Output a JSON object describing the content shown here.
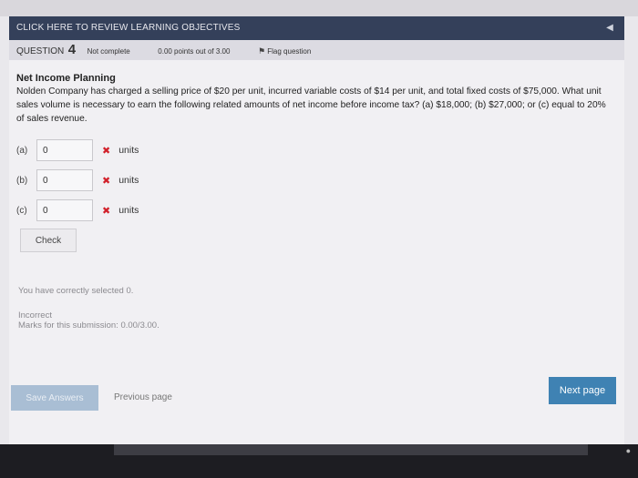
{
  "objectives_bar": {
    "label": "CLICK HERE TO REVIEW LEARNING OBJECTIVES"
  },
  "question_bar": {
    "question_label": "QUESTION",
    "question_number": "4",
    "status": "Not complete",
    "points": "0.00 points out of 3.00",
    "flag_label": "Flag question"
  },
  "question": {
    "title": "Net Income Planning",
    "text": "Nolden Company has charged a selling price of $20 per unit, incurred variable costs of $14 per unit, and total fixed costs of $75,000. What unit sales volume is necessary to earn the following related amounts of net income before income tax? (a) $18,000; (b) $27,000; or (c) equal to 20% of sales revenue."
  },
  "answers": [
    {
      "label": "(a)",
      "value": "0",
      "unit": "units",
      "mark": "✖"
    },
    {
      "label": "(b)",
      "value": "0",
      "unit": "units",
      "mark": "✖"
    },
    {
      "label": "(c)",
      "value": "0",
      "unit": "units",
      "mark": "✖"
    }
  ],
  "check_button": "Check",
  "feedback": {
    "selected": "You have correctly selected 0.",
    "result": "Incorrect",
    "marks": "Marks for this submission: 0.00/3.00."
  },
  "footer": {
    "save_answers": "Save Answers",
    "previous_page": "Previous page",
    "next_page": "Next page"
  },
  "colors": {
    "header": "#34405a",
    "accent": "#3f82b3",
    "error": "#d2202a"
  }
}
